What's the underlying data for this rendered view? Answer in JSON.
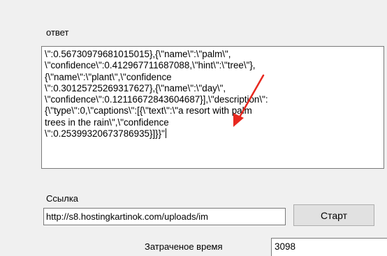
{
  "answer": {
    "label": "ответ",
    "text": "\\\":0.56730979681015015},{\\\"name\\\":\\\"palm\\\",\n\\\"confidence\\\":0.412967711687088,\\\"hint\\\":\\\"tree\\\"},\n{\\\"name\\\":\\\"plant\\\",\\\"confidence\n\\\":0.30125725269317627},{\\\"name\\\":\\\"day\\\",\n\\\"confidence\\\":0.12116672843604687}],\\\"description\\\":\n{\\\"type\\\":0,\\\"captions\\\":[{\\\"text\\\":\\\"a resort with palm\ntrees in the rain\\\",\\\"confidence\n\\\":0.25399320673786935}]}}\""
  },
  "link": {
    "label": "Ссылка",
    "value": "http://s8.hostingkartinok.com/uploads/im"
  },
  "start_button": "Старт",
  "elapsed": {
    "label": "Затраченое время",
    "value": "3098"
  },
  "annotation": {
    "arrow_color": "#e8281f"
  }
}
